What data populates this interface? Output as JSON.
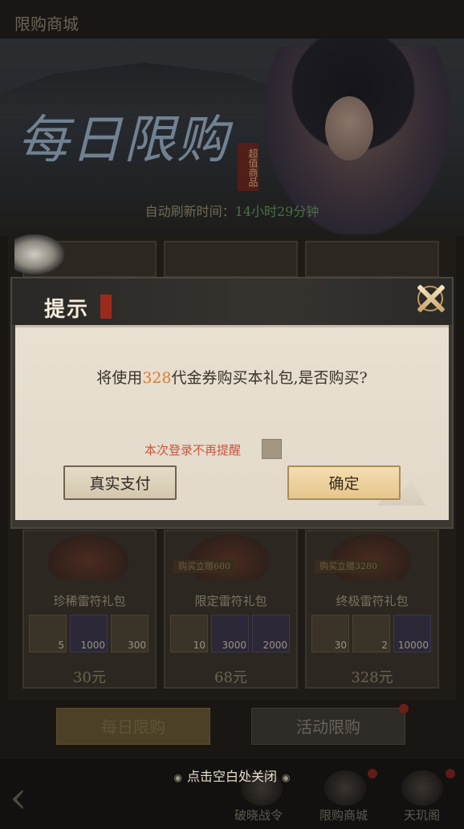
{
  "page": {
    "title": "限购商城"
  },
  "banner": {
    "title": "每日限购",
    "seal": "超值商品",
    "refresh_label": "自动刷新时间：",
    "refresh_time": "14小时29分钟"
  },
  "cards": [
    {
      "name": "珍稀雷符礼包",
      "ribbon": "",
      "items": [
        {
          "count": "5",
          "rarity": "gold"
        },
        {
          "count": "1000",
          "rarity": "purple"
        },
        {
          "count": "300",
          "rarity": "gold"
        }
      ],
      "price": "30元"
    },
    {
      "name": "限定雷符礼包",
      "ribbon": "购买立赠680",
      "items": [
        {
          "count": "10",
          "rarity": "gold"
        },
        {
          "count": "3000",
          "rarity": "purple"
        },
        {
          "count": "2000",
          "rarity": "purple"
        }
      ],
      "price": "68元"
    },
    {
      "name": "终极雷符礼包",
      "ribbon": "购买立赠3280",
      "items": [
        {
          "count": "30",
          "rarity": "gold"
        },
        {
          "count": "2",
          "rarity": "gold"
        },
        {
          "count": "10000",
          "rarity": "purple"
        }
      ],
      "price": "328元"
    }
  ],
  "tabs": {
    "daily": "每日限购",
    "event": "活动限购"
  },
  "bottom_nav": {
    "battle_pass": "破晓战令",
    "shop": "限购商城",
    "pavilion": "天玑阁"
  },
  "close_hint": "点击空白处关闭",
  "dialog": {
    "title": "提示",
    "message_prefix": "将使用",
    "amount": "328",
    "message_suffix": "代金券购买本礼包,是否购买?",
    "remind_label": "本次登录不再提醒",
    "remind_checked": false,
    "pay_button": "真实支付",
    "confirm_button": "确定"
  },
  "colors": {
    "amount_highlight": "#e07a2e",
    "remind_text": "#c9573f",
    "dialog_body": "#e8e0d1",
    "confirm_button": "#f3ddb0"
  }
}
